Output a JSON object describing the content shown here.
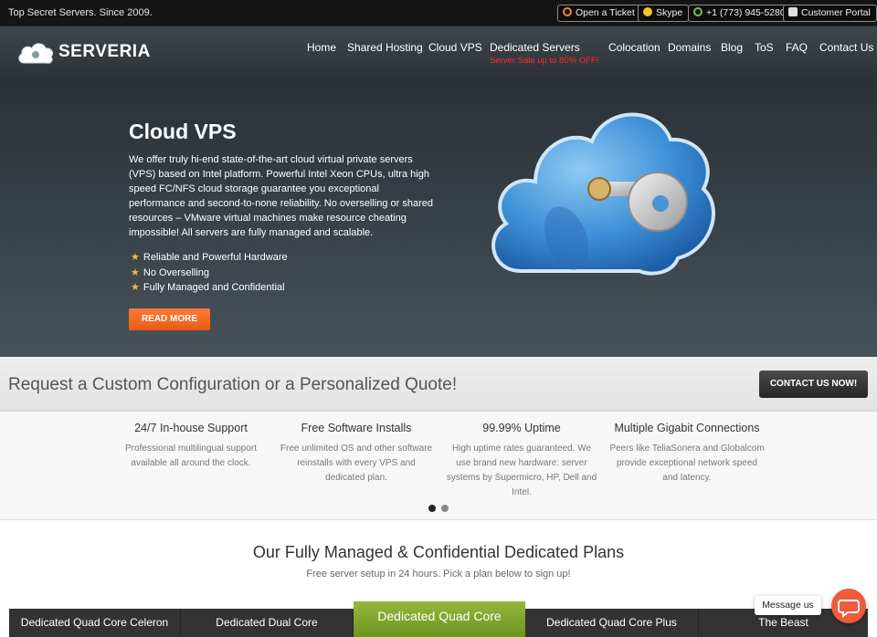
{
  "topbar": {
    "tagline": "Top Secret Servers. Since 2009.",
    "buttons": [
      {
        "label": "Open a Ticket",
        "icon": "lifebuoy-icon"
      },
      {
        "label": "Skype",
        "icon": "skype-icon"
      },
      {
        "label": "+1 (773) 945-5280",
        "icon": "phone-icon"
      },
      {
        "label": "Customer Portal",
        "icon": "user-icon"
      }
    ]
  },
  "header": {
    "logo_text": "SERVERIA",
    "nav": [
      {
        "label": "Home"
      },
      {
        "label": "Shared Hosting"
      },
      {
        "label": "Cloud VPS"
      },
      {
        "label": "Dedicated Servers",
        "sub": "Server Sale up to 80% OFF!"
      },
      {
        "label": "Colocation"
      },
      {
        "label": "Domains"
      },
      {
        "label": "Blog"
      },
      {
        "label": "ToS"
      },
      {
        "label": "FAQ"
      },
      {
        "label": "Contact Us"
      }
    ]
  },
  "hero": {
    "title": "Cloud VPS",
    "description": "We offer truly hi-end state-of-the-art cloud virtual private servers (VPS) based on Intel platform. Powerful Intel Xeon CPUs, ultra high speed FC/NFS cloud storage guarantee you exceptional performance and second-to-none reliability. No overselling or shared resources – VMware virtual machines make resource cheating impossible! All servers are fully managed and scalable.",
    "features": [
      "Reliable and Powerful Hardware",
      "No Overselling",
      "Fully Managed and Confidential"
    ],
    "button": "READ MORE"
  },
  "quote": {
    "text": "Request a Custom Configuration or a Personalized Quote!",
    "button": "CONTACT US NOW!"
  },
  "features": [
    {
      "title": "24/7 In-house Support",
      "desc": "Professional multilingual support available all around the clock."
    },
    {
      "title": "Free Software Installs",
      "desc": "Free unlimited OS and other software reinstalls with every VPS and dedicated plan."
    },
    {
      "title": "99.99% Uptime",
      "desc": "High uptime rates guaranteed. We use brand new hardware: server systems by Supermicro, HP, Dell and Intel."
    },
    {
      "title": "Multiple Gigabit Connections",
      "desc": "Peers like TeliaSonera and Globalcom provide exceptional network speed and latency."
    }
  ],
  "plans": {
    "title": "Our Fully Managed & Confidential Dedicated Plans",
    "subtitle": "Free server setup in 24 hours. Pick a plan below to sign up!",
    "tabs": [
      "Dedicated Quad Core Celeron",
      "Dedicated Dual Core",
      "Dedicated Quad Core",
      "Dedicated Quad Core Plus",
      "The Beast"
    ],
    "active_tab": "Dedicated Quad Core"
  },
  "chat": {
    "label": "Message us"
  },
  "colors": {
    "accent_orange": "#f26a21",
    "sale_red": "#ff2a2a",
    "tab_green": "#7ea62a"
  }
}
